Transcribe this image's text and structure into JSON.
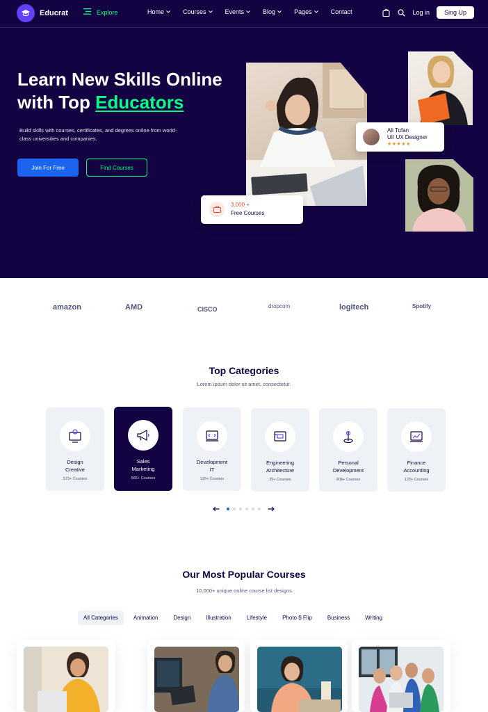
{
  "nav": {
    "logo": "Educrat",
    "explore": "Explore",
    "menu": [
      {
        "label": "Home"
      },
      {
        "label": "Courses"
      },
      {
        "label": "Events"
      },
      {
        "label": "Blog"
      },
      {
        "label": "Pages"
      },
      {
        "label": "Contact"
      }
    ],
    "login": "Log in",
    "signup": "Sing Up"
  },
  "hero": {
    "title_line1": "Learn New Skills Online",
    "title_line2_prefix": "with Top ",
    "title_accent": "Educators",
    "subtitle": "Build skills with courses, certificates, and degrees online from world-class universities and companies.",
    "btn_primary": "Join For Free",
    "btn_secondary": "Find Courses",
    "instructor_card": {
      "name": "Ali Tufan",
      "role": "UI/ UX Designer",
      "stars": "★★★★★"
    },
    "free_card": {
      "count": "3,000 +",
      "label": "Free Courses"
    }
  },
  "brands": [
    "amazon",
    "AMD",
    "CISCO",
    "dropcom",
    "logitech",
    "Spotify"
  ],
  "categories_section": {
    "title": "Top Categories",
    "subtitle": "Lorem ipsum dolor sit amet, consectetur.",
    "items": [
      {
        "line1": "Design",
        "line2": "Creative",
        "count": "573+ Courses",
        "icon": "design-icon"
      },
      {
        "line1": "Sales",
        "line2": "Marketing",
        "count": "565+ Courses",
        "icon": "megaphone-icon"
      },
      {
        "line1": "Development",
        "line2": "IT",
        "count": "126+ Courses",
        "icon": "code-icon"
      },
      {
        "line1": "Engineering",
        "line2": "Architecture",
        "count": "35+ Courses",
        "icon": "blueprint-icon"
      },
      {
        "line1": "Personal",
        "line2": "Development",
        "count": "908+ Courses",
        "icon": "target-icon"
      },
      {
        "line1": "Finance",
        "line2": "Accounting",
        "count": "129+ Courses",
        "icon": "chart-icon"
      }
    ]
  },
  "courses_section": {
    "title": "Our Most Popular Courses",
    "subtitle": "10,000+ unique online course list designs",
    "tabs": [
      "All Categories",
      "Animation",
      "Design",
      "Illustration",
      "Lifestyle",
      "Photo $ Flip",
      "Business",
      "Writing"
    ]
  },
  "colors": {
    "bg_dark": "#140342",
    "accent_green": "#00FF84",
    "primary_blue": "#1A64F0",
    "purple": "#6440FB"
  }
}
